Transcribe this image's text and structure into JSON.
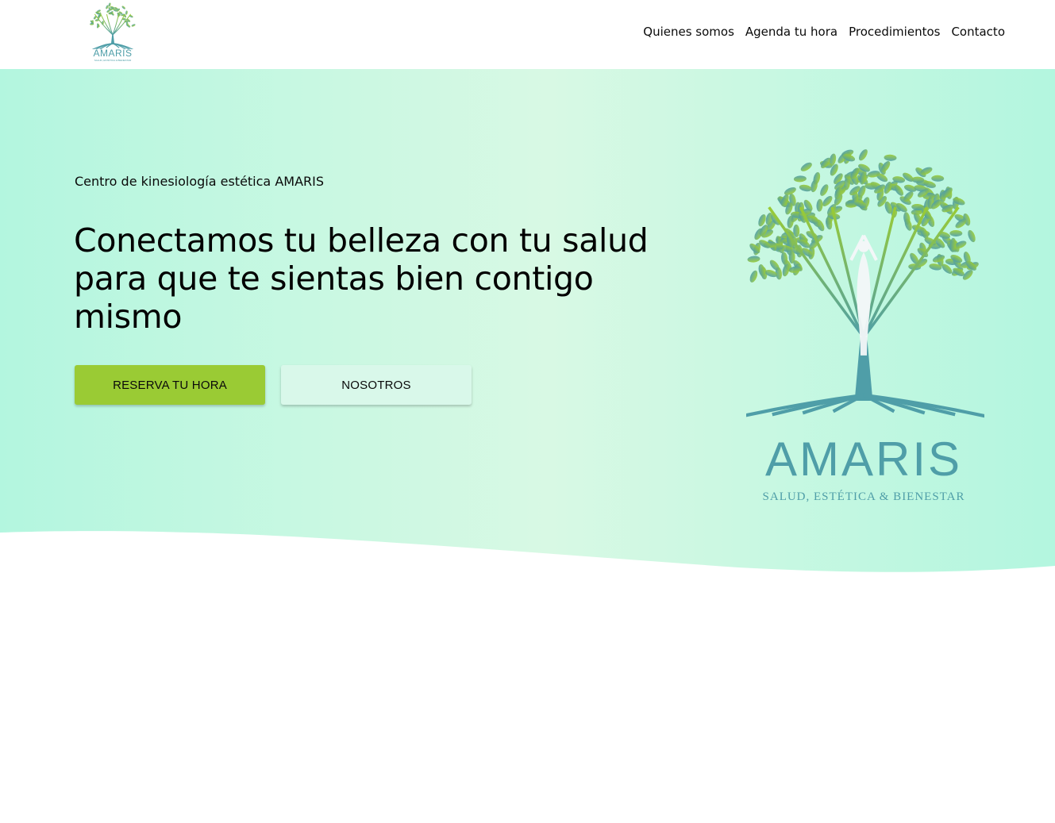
{
  "colors": {
    "hero_gradient_edge": "#b3f6df",
    "hero_gradient_center": "#d8f9e4",
    "reserve_button": "#9acb34",
    "about_button": "#d9f8ea",
    "logo_leaf_top": "#9acb34",
    "logo_leaf_bottom": "#4f9ea8",
    "logo_text": "#4f9ea8"
  },
  "brand": {
    "name": "AMARIS",
    "tagline": "SALUD, ESTÉTICA & BIENESTAR",
    "header_logo_icon": "tree-of-life-logo",
    "hero_logo_icon": "tree-of-life-yoga-figure-logo"
  },
  "nav": {
    "items": [
      {
        "label": "Quienes somos"
      },
      {
        "label": "Agenda tu hora"
      },
      {
        "label": "Procedimientos"
      },
      {
        "label": "Contacto"
      }
    ]
  },
  "hero": {
    "eyebrow": "Centro de kinesiología estética AMARIS",
    "title": "Conectamos tu belleza con tu salud para que te sientas bien contigo mismo",
    "primary_button": "RESERVA TU HORA",
    "secondary_button": "NOSOTROS"
  }
}
